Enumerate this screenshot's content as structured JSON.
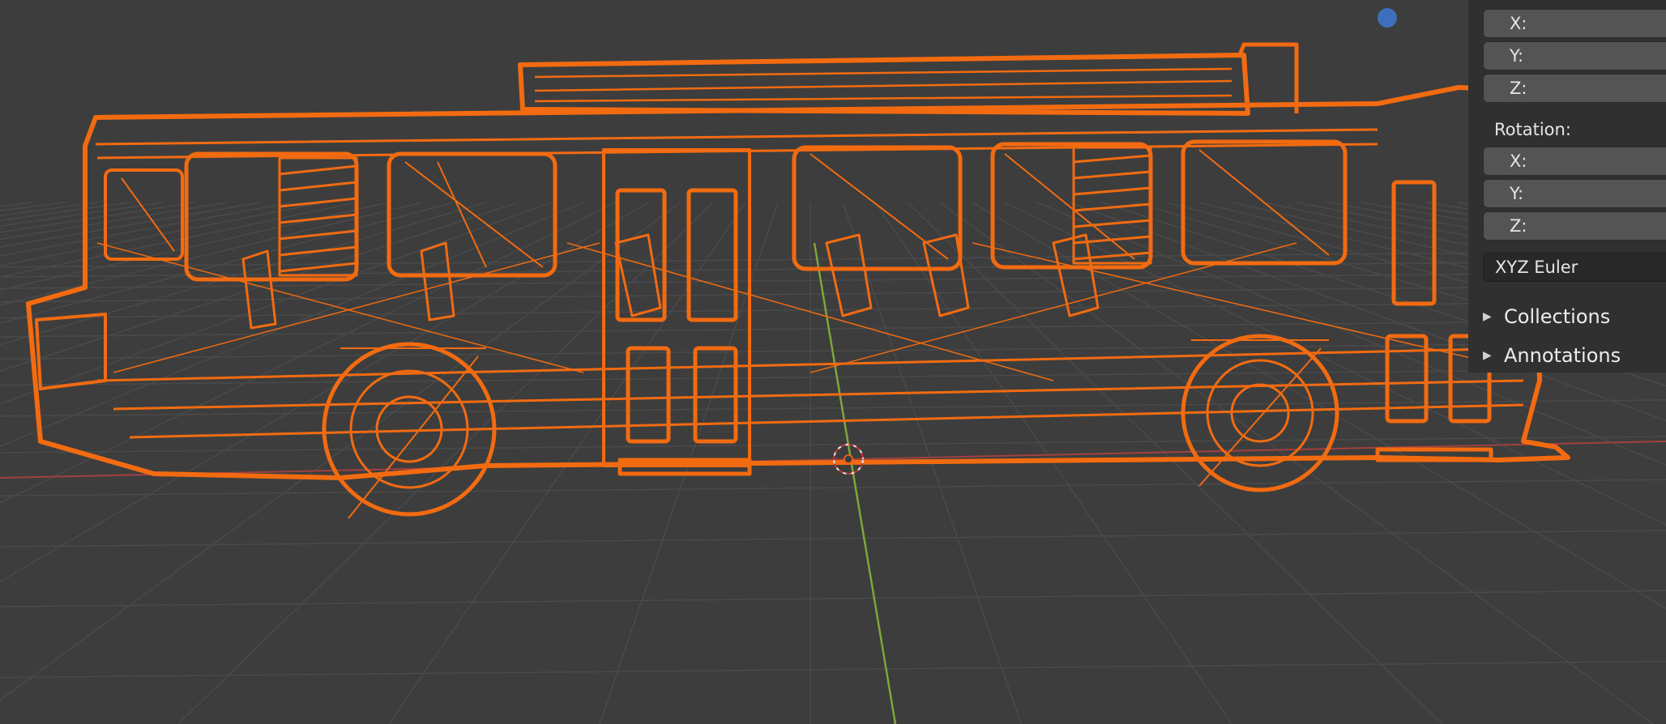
{
  "viewport": {
    "colors": {
      "background": "#3d3d3d",
      "grid": "#4a4a4a",
      "x_axis": "#a04040",
      "y_axis": "#7fa53b",
      "selection": "#f26b10",
      "gizmo_blue": "#3d6fbd"
    }
  },
  "properties": {
    "location_fields": [
      {
        "axis": "X:"
      },
      {
        "axis": "Y:"
      },
      {
        "axis": "Z:"
      }
    ],
    "rotation_label": "Rotation:",
    "rotation_fields": [
      {
        "axis": "X:"
      },
      {
        "axis": "Y:"
      },
      {
        "axis": "Z:"
      }
    ],
    "rotation_mode": "XYZ Euler",
    "panels": [
      {
        "label": "Collections",
        "icon": "triangle-right-icon"
      },
      {
        "label": "Annotations",
        "icon": "triangle-right-icon"
      }
    ]
  }
}
